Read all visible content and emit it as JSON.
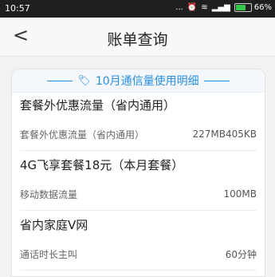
{
  "status_bar": {
    "time": "10:57",
    "signal_text": "... ",
    "battery_percent": "66%",
    "battery_level": 0.66
  },
  "app_bar": {
    "back_icon": "chevron-left-icon",
    "back_glyph": "<",
    "title": "账单查询"
  },
  "banner": {
    "icon": "tag-icon",
    "icon_glyph": "🏷",
    "text": "10月通信量使用明细"
  },
  "sections": [
    {
      "title": "套餐外优惠流量（省内通用）",
      "rows": [
        {
          "label": "套餐外优惠流量（省内通用）",
          "value": "227MB405KB"
        }
      ]
    },
    {
      "title": "4G飞享套餐18元（本月套餐）",
      "rows": [
        {
          "label": "移动数据流量",
          "value": "100MB"
        }
      ]
    },
    {
      "title": "省内家庭V网",
      "rows": [
        {
          "label": "通话时长主叫",
          "value": "60分钟"
        }
      ]
    }
  ],
  "colors": {
    "accent": "#2a8fe3",
    "status_bar_bg": "#1f1f1f",
    "battery_fill": "#35c84a"
  }
}
